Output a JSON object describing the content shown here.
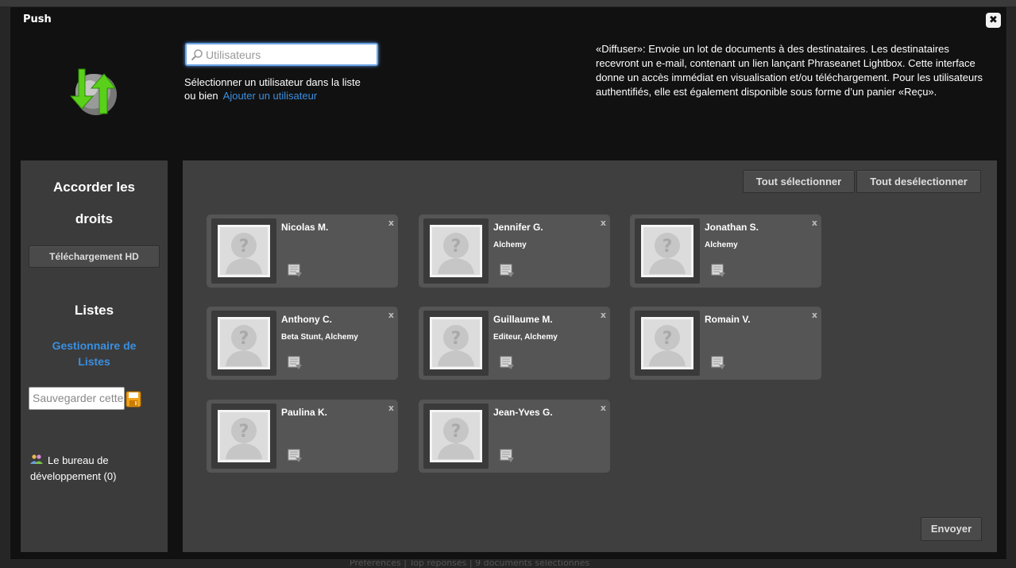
{
  "background": {
    "status_text": "Préférences | Top réponses | 9 documents sélectionnés"
  },
  "modal": {
    "title": "Push",
    "close_symbol": "✖",
    "logo_icon": "push-arrows-icon"
  },
  "search": {
    "placeholder": "Utilisateurs",
    "value": "",
    "instruction": "Sélectionner un utilisateur dans la liste",
    "or_text": "ou bien",
    "add_user_link": "Ajouter un utilisateur"
  },
  "description": "«Diffuser»: Envoie un lot de documents à des destinataires. Les destinataires recevront un e-mail, contenant un lien lançant Phraseanet Lightbox. Cette interface donne un accès immédiat en visualisation et/ou téléchargement. Pour les utilisateurs authentifiés, elle est également disponible sous forme d’un panier «Reçu».",
  "sidebar": {
    "rights_heading_1": "Accorder les",
    "rights_heading_2": "droits",
    "hd_button": "Téléchargement HD",
    "lists_heading": "Listes",
    "list_manager_1": "Gestionnaire de",
    "list_manager_2": "Listes",
    "save_placeholder": "Sauvegarder cette liste",
    "group_label_1": "Le bureau de",
    "group_label_2": "développement (0)"
  },
  "main": {
    "select_all": "Tout sélectionner",
    "deselect_all": "Tout desélectionner",
    "send_button": "Envoyer",
    "remove_symbol": "x",
    "users": [
      {
        "name": "Nicolas M.",
        "org": ""
      },
      {
        "name": "Jennifer G.",
        "org": "Alchemy"
      },
      {
        "name": "Jonathan S.",
        "org": "Alchemy"
      },
      {
        "name": "Anthony C.",
        "org": "Beta Stunt, Alchemy"
      },
      {
        "name": "Guillaume M.",
        "org": "Editeur, Alchemy"
      },
      {
        "name": "Romain V.",
        "org": ""
      },
      {
        "name": "Paulina K.",
        "org": ""
      },
      {
        "name": "Jean-Yves G.",
        "org": ""
      }
    ]
  },
  "colors": {
    "accent_link": "#3a8fe0",
    "modal_bg": "#111111",
    "panel_bg": "#3f3f3f",
    "card_bg": "#555555"
  }
}
